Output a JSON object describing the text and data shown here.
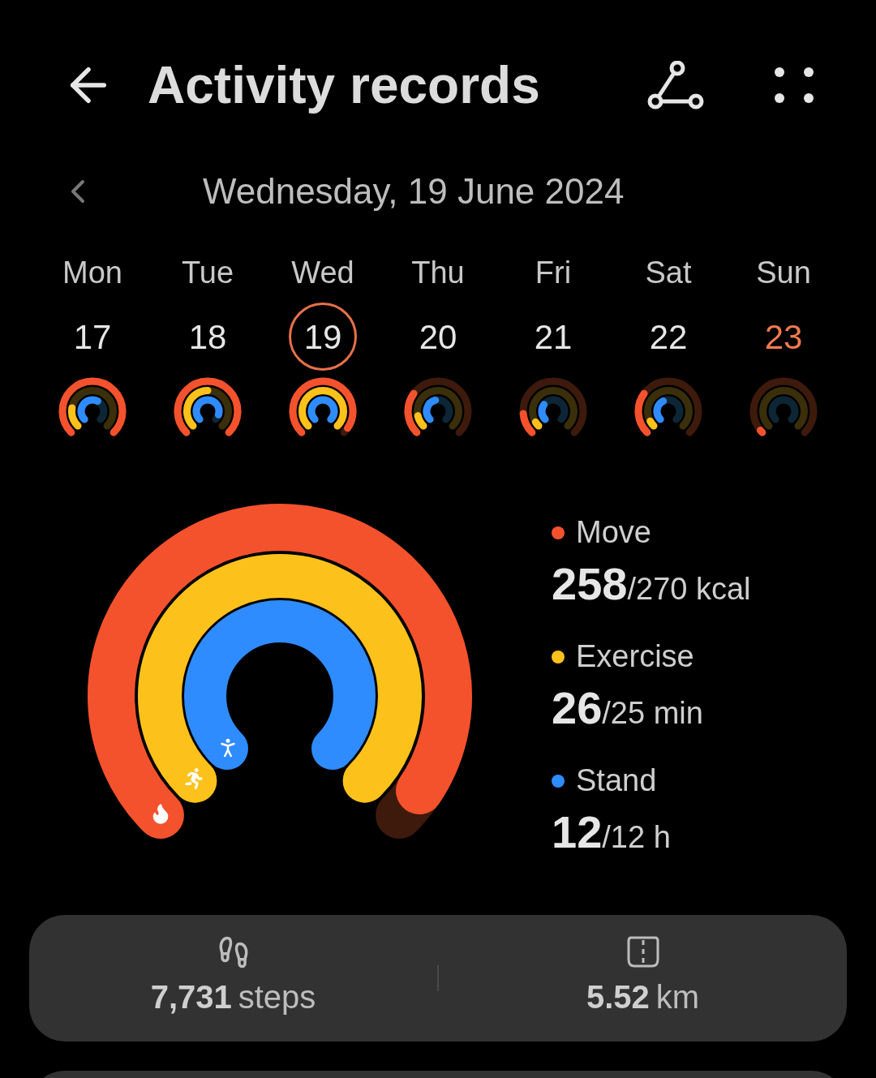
{
  "header": {
    "title": "Activity records"
  },
  "date_bar": {
    "date": "Wednesday, 19 June 2024"
  },
  "days": [
    {
      "weekday": "Mon",
      "date": "17",
      "selected": false,
      "highlighted": false
    },
    {
      "weekday": "Tue",
      "date": "18",
      "selected": false,
      "highlighted": false
    },
    {
      "weekday": "Wed",
      "date": "19",
      "selected": true,
      "highlighted": false
    },
    {
      "weekday": "Thu",
      "date": "20",
      "selected": false,
      "highlighted": false
    },
    {
      "weekday": "Fri",
      "date": "21",
      "selected": false,
      "highlighted": false
    },
    {
      "weekday": "Sat",
      "date": "22",
      "selected": false,
      "highlighted": false
    },
    {
      "weekday": "Sun",
      "date": "23",
      "selected": false,
      "highlighted": true
    }
  ],
  "goals": [
    {
      "kind": "move",
      "name": "Move",
      "color": "#f4522d",
      "value": "258",
      "target": "/270 kcal"
    },
    {
      "kind": "exercise",
      "name": "Exercise",
      "color": "#fcc21b",
      "value": "26",
      "target": "/25 min"
    },
    {
      "kind": "stand",
      "name": "Stand",
      "color": "#2f8cff",
      "value": "12",
      "target": "/12 h"
    }
  ],
  "summary": [
    {
      "kind": "steps",
      "value": "7,731",
      "unit": "steps"
    },
    {
      "kind": "distance",
      "value": "5.52",
      "unit": "km"
    }
  ]
}
